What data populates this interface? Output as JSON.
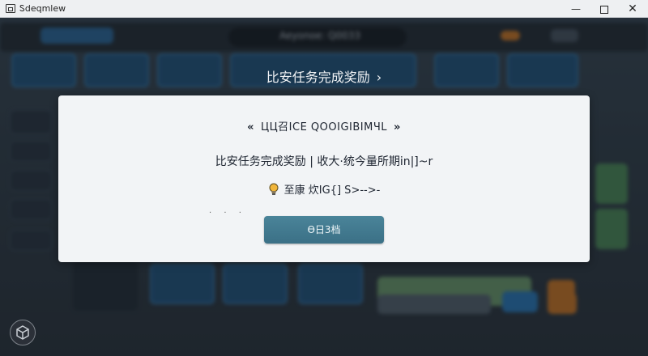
{
  "window": {
    "title": "Ꮪdeqmlew",
    "minimize_glyph": "—",
    "close_glyph": "✕"
  },
  "background": {
    "server_label": "Aeyonoe: Q0033"
  },
  "page": {
    "title": "比安任务完成奖励",
    "title_chevron": "›"
  },
  "dialog": {
    "heading_left": "«",
    "heading": "ЦЦ召ІСЕ QOOIGIBIMЧL",
    "heading_right": "»",
    "message": "比安任务完成奖励 | 收大·统今量所期in|]~r",
    "reward_text": "至康 炊IG{] S>-->-",
    "dots": "· · ·",
    "confirm_label": "Ѳ日3档"
  },
  "icons": {
    "app": "app-window-icon",
    "bulb": "lightbulb-icon",
    "cube": "cube-icon"
  },
  "colors": {
    "dialog_bg": "#f2f4f6",
    "confirm_bg": "#427a90",
    "tile_blue": "#25567f",
    "accent_green": "#4f8a5c",
    "accent_orange": "#c9782a"
  }
}
